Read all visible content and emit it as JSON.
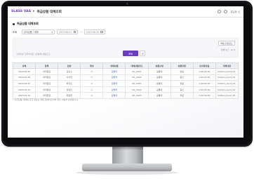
{
  "app": {
    "brand": "SLASS VAA",
    "separator": "▸",
    "page_title": "취급상품 대체조회",
    "top_right_text": "홍길동 님"
  },
  "section": {
    "title": "취급상품 대체조회"
  },
  "filter": {
    "label": "조회",
    "select_value": "유의상품 / 대체",
    "date_from": "2023.06.01",
    "date_to": "2023.06.30",
    "date_separator": "~"
  },
  "search": {
    "placeholder": "검색어를 입력하세요 (상품명/상품코드)",
    "search_label": "조회",
    "reset_label": "↺",
    "excel_label": "엑셀 다운로드",
    "total_text": "전체 5건 · 10 ▾"
  },
  "table": {
    "columns": [
      "상태",
      "등록",
      "담당",
      "항상",
      "대체상품",
      "대체상품코드",
      "상품규정",
      "상품유형",
      "유의종료일",
      "대체내용"
    ],
    "rows": [
      [
        "2023.06.30",
        "처리완료",
        "김민수",
        "A",
        "김명국",
        "RA_0421",
        "공통대",
        "처음",
        "1.99.09.30",
        "holders_bond_01"
      ],
      [
        "2023.06.28",
        "처리완료",
        "이서연",
        "A",
        "김명국",
        "RA_0422",
        "공통대",
        "중간",
        "1.99.09.30",
        "holders_bond_02"
      ],
      [
        "2023.06.22",
        "처리완료",
        "박지훈",
        "A",
        "김명국",
        "RA_0423",
        "공통대",
        "처음",
        "1.99.09.30",
        "holders_bond_03"
      ],
      [
        "2023.06.15",
        "처리완료",
        "정유진",
        "A",
        "김명국",
        "RA_0424",
        "공통대",
        "중간",
        "1.99.09.30",
        "holders_bond_04"
      ],
      [
        "2023.06.10",
        "처리완료",
        "최동현",
        "A",
        "김명국",
        "RA_0425",
        "공통대",
        "처음",
        "1.99.09.30",
        "holders_bond_05"
      ]
    ]
  },
  "note": "* 취급상품 대체에 관한 정보는 매일 업데이트되며 최신 내용을 반영합니다.",
  "colors": {
    "accent": "#6a3cc4",
    "link": "#2f56b8"
  }
}
